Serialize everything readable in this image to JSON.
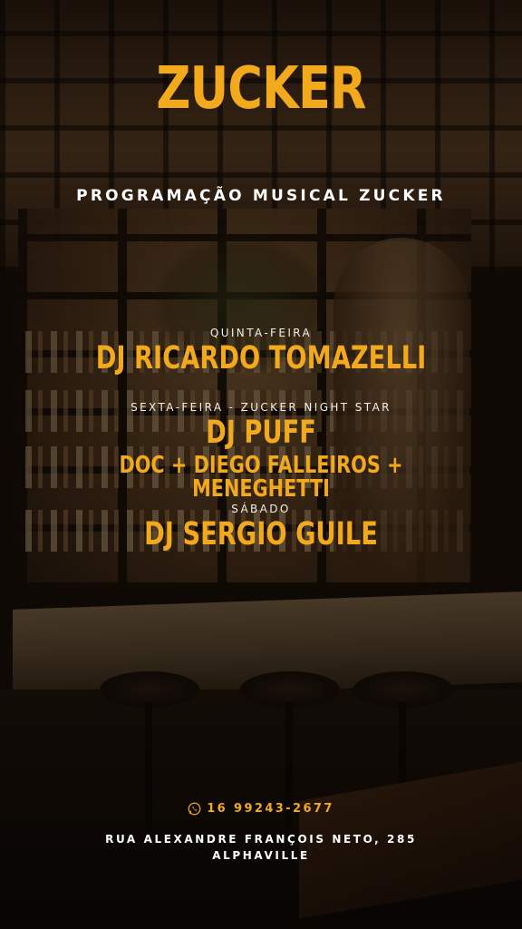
{
  "brand": {
    "logo": "ZUCKER",
    "accent_color": "#f2a91c"
  },
  "title": "PROGRAMAÇÃO MUSICAL ZUCKER",
  "schedule": [
    {
      "day": "QUINTA-FEIRA",
      "artists": [
        "DJ RICARDO TOMAZELLI"
      ]
    },
    {
      "day": "SEXTA-FEIRA - ZUCKER NIGHT STAR",
      "artists": [
        "DJ PUFF",
        "DOC + DIEGO FALLEIROS + MENEGHETTI"
      ]
    },
    {
      "day": "SÁBADO",
      "artists": [
        "DJ SERGIO GUILE"
      ]
    }
  ],
  "contact": {
    "icon": "whatsapp-icon",
    "phone": "16 99243-2677",
    "address_line1": "RUA ALEXANDRE FRANÇOIS NETO, 285",
    "address_line2": "ALPHAVILLE"
  }
}
